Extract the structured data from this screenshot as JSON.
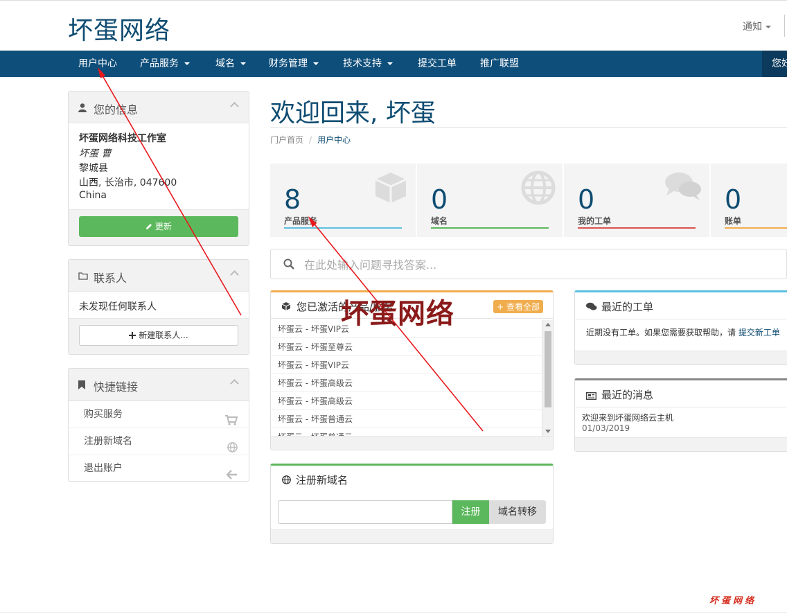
{
  "header": {
    "logo": "坏蛋网络",
    "notifications_label": "通知"
  },
  "nav": {
    "items": [
      {
        "label": "用户中心"
      },
      {
        "label": "产品服务"
      },
      {
        "label": "域名"
      },
      {
        "label": "财务管理"
      },
      {
        "label": "技术支持"
      },
      {
        "label": "提交工单"
      },
      {
        "label": "推广联盟"
      }
    ],
    "right_label": "您好"
  },
  "sidebar": {
    "your_info": {
      "title": "您的信息",
      "company": "坏蛋网络科技工作室",
      "name": "坏蛋 曹",
      "address1": "黎城县",
      "address2": "山西, 长治市, 047600",
      "country": "China",
      "update_label": "更新"
    },
    "contacts": {
      "title": "联系人",
      "empty_text": "未发现任何联系人",
      "new_label": "新建联系人..."
    },
    "shortcuts": {
      "title": "快捷链接",
      "items": [
        {
          "label": "购买服务",
          "icon": "cart-icon"
        },
        {
          "label": "注册新域名",
          "icon": "globe-icon"
        },
        {
          "label": "退出账户",
          "icon": "arrow-left-icon"
        }
      ]
    }
  },
  "main": {
    "welcome": "欢迎回来, 坏蛋",
    "breadcrumb": {
      "home": "门户首页",
      "current": "用户中心"
    },
    "stats": [
      {
        "value": "8",
        "label": "产品服务",
        "color": "#5bc0de",
        "icon": "cube-icon"
      },
      {
        "value": "0",
        "label": "域名",
        "color": "#5cb85c",
        "icon": "globe-icon"
      },
      {
        "value": "0",
        "label": "我的工单",
        "color": "#d9534f",
        "icon": "comments-icon"
      },
      {
        "value": "0",
        "label": "账单",
        "color": "#f0ad4e",
        "icon": "invoice-icon"
      }
    ],
    "search_placeholder": "在此处输入问题寻找答案...",
    "active_products": {
      "title": "您已激活的产品/服务",
      "view_all_label": "查看全部",
      "accent": "#f0ad4e",
      "items": [
        "坏蛋云 - 坏蛋VIP云",
        "坏蛋云 - 坏蛋至尊云",
        "坏蛋云 - 坏蛋VIP云",
        "坏蛋云 - 坏蛋高级云",
        "坏蛋云 - 坏蛋高级云",
        "坏蛋云 - 坏蛋普通云",
        "坏蛋云 - 坏蛋普通云"
      ]
    },
    "register_domain": {
      "title": "注册新域名",
      "register_label": "注册",
      "transfer_label": "域名转移",
      "accent": "#5cb85c"
    },
    "recent_tickets": {
      "title": "最近的工单",
      "text": "近期没有工单。如果您需要获取帮助，请",
      "link": "提交新工单",
      "accent": "#5bc0de"
    },
    "recent_news": {
      "title": "最近的消息",
      "item_title": "欢迎来到坏蛋网络云主机",
      "item_date": "01/03/2019",
      "accent": "#888888"
    }
  },
  "watermark": {
    "overlay": "坏蛋网络",
    "corner": "坏蛋网络"
  },
  "annotation_color": "#e8191d"
}
